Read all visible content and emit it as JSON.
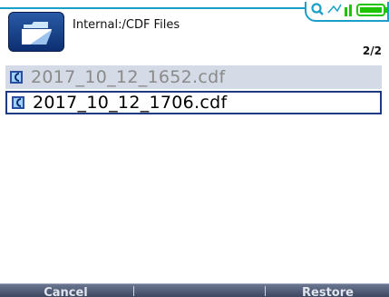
{
  "header": {
    "path_title": "Internal:/CDF Files",
    "page_counter": "2/2",
    "folder_icon": "open-folder-icon",
    "status_icons": [
      "search-icon",
      "signal-icon",
      "battery-icon"
    ]
  },
  "files": [
    {
      "name": "2017_10_12_1652.cdf",
      "icon": "cdf-file-icon",
      "selected": false
    },
    {
      "name": "2017_10_12_1706.cdf",
      "icon": "cdf-file-icon",
      "selected": true
    }
  ],
  "softkeys": {
    "cancel_label": "Cancel",
    "restore_label": "Restore"
  },
  "colors": {
    "accent": "#1aa0c8",
    "selection_border": "#1e3a80",
    "row_highlight": "#d4dbe6",
    "battery_green": "#1fc400"
  }
}
